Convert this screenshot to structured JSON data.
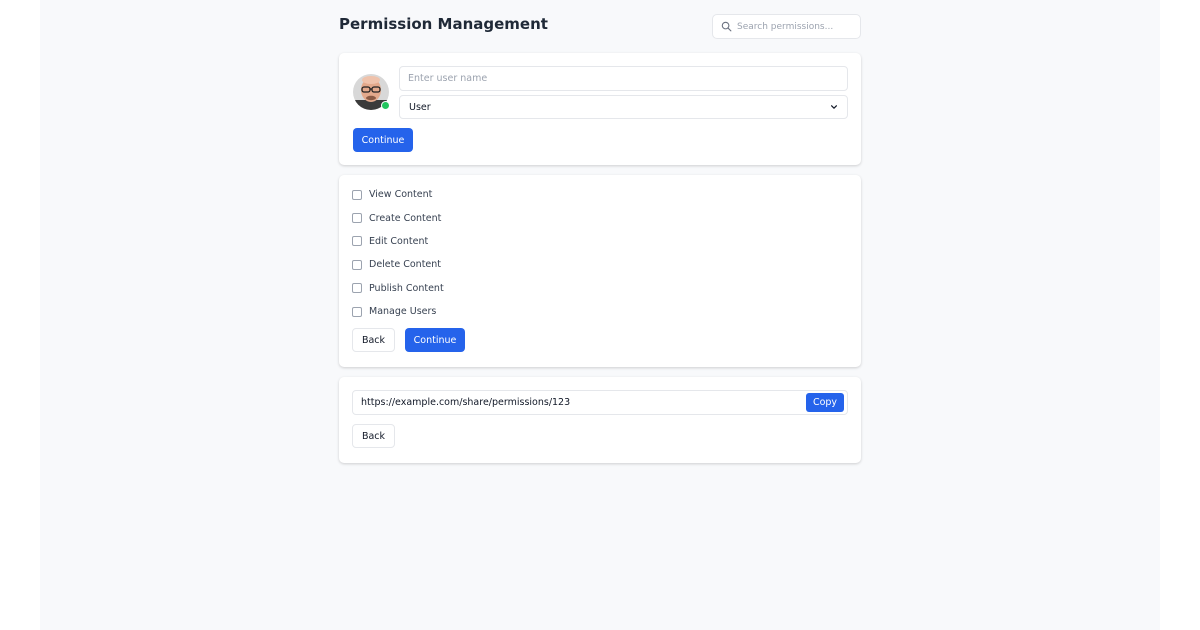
{
  "header": {
    "title": "Permission Management",
    "search_placeholder": "Search permissions..."
  },
  "user_step": {
    "name_placeholder": "Enter user name",
    "role_value": "User",
    "continue_label": "Continue",
    "status_color": "#22c55e"
  },
  "permissions_step": {
    "items": [
      {
        "label": "View Content"
      },
      {
        "label": "Create Content"
      },
      {
        "label": "Edit Content"
      },
      {
        "label": "Delete Content"
      },
      {
        "label": "Publish Content"
      },
      {
        "label": "Manage Users"
      }
    ],
    "back_label": "Back",
    "continue_label": "Continue"
  },
  "share_step": {
    "url": "https://example.com/share/permissions/123",
    "copy_label": "Copy",
    "back_label": "Back"
  },
  "colors": {
    "primary": "#2563eb",
    "background": "#f8f9fb",
    "card": "#ffffff"
  }
}
